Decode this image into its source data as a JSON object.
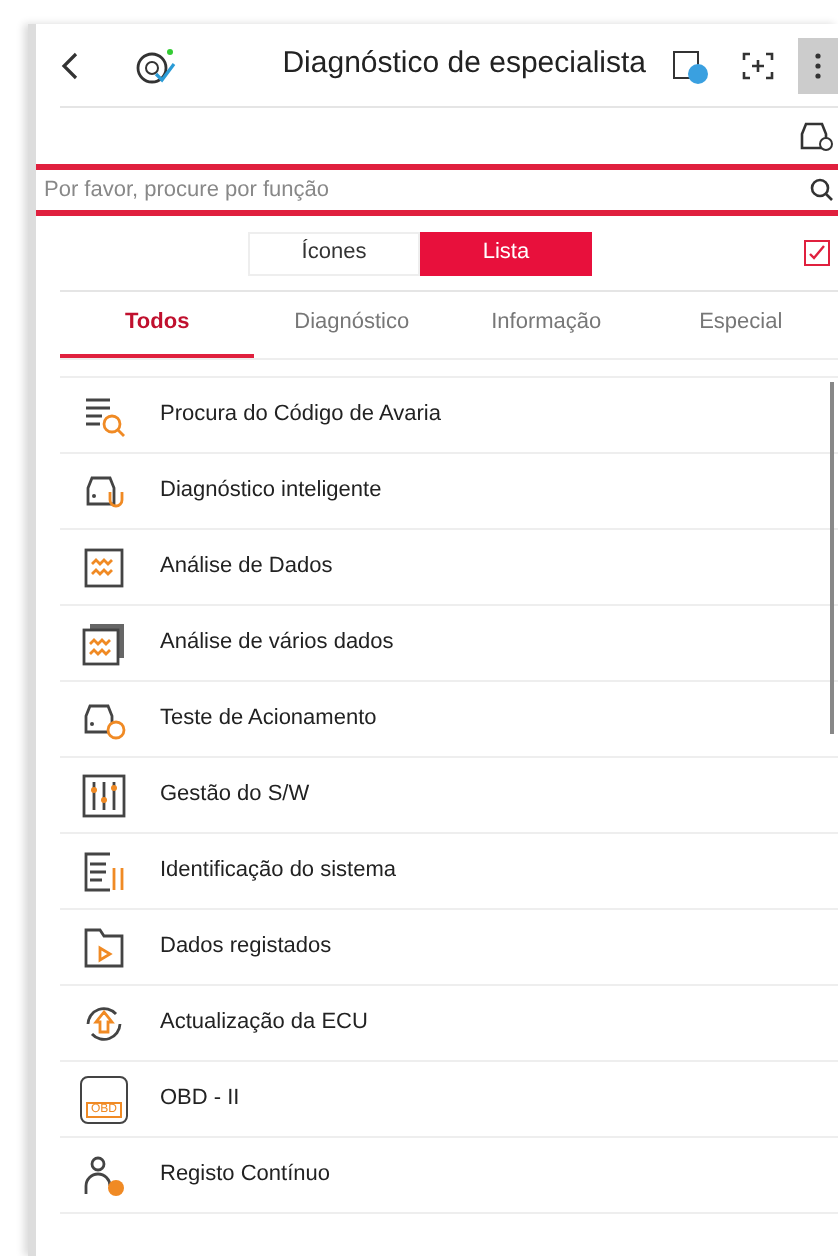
{
  "header": {
    "title": "Diagnóstico de especialista"
  },
  "search": {
    "placeholder": "Por favor, procure por função"
  },
  "view_toggle": [
    {
      "label": "Ícones",
      "selected": false
    },
    {
      "label": "Lista",
      "selected": true
    }
  ],
  "select_all": {
    "checked": true
  },
  "tabs": [
    {
      "label": "Todos",
      "selected": true
    },
    {
      "label": "Diagnóstico",
      "selected": false
    },
    {
      "label": "Informação",
      "selected": false
    },
    {
      "label": "Especial",
      "selected": false
    }
  ],
  "functions": [
    {
      "label": "Procura do Código de Avaria",
      "kind": "code-search"
    },
    {
      "label": "Diagnóstico inteligente",
      "kind": "car-stethoscope"
    },
    {
      "label": "Análise de Dados",
      "kind": "data"
    },
    {
      "label": "Análise de vários dados",
      "kind": "multi-data"
    },
    {
      "label": "Teste de Acionamento",
      "kind": "car-actuation"
    },
    {
      "label": "Gestão do S/W",
      "kind": "sliders"
    },
    {
      "label": "Identificação do sistema",
      "kind": "system-id"
    },
    {
      "label": "Dados registados",
      "kind": "folder-play"
    },
    {
      "label": "Actualização da ECU",
      "kind": "update"
    },
    {
      "label": "OBD - II",
      "kind": "obd",
      "badge": "OBD"
    },
    {
      "label": "Registo Contínuo",
      "kind": "person-record"
    }
  ]
}
